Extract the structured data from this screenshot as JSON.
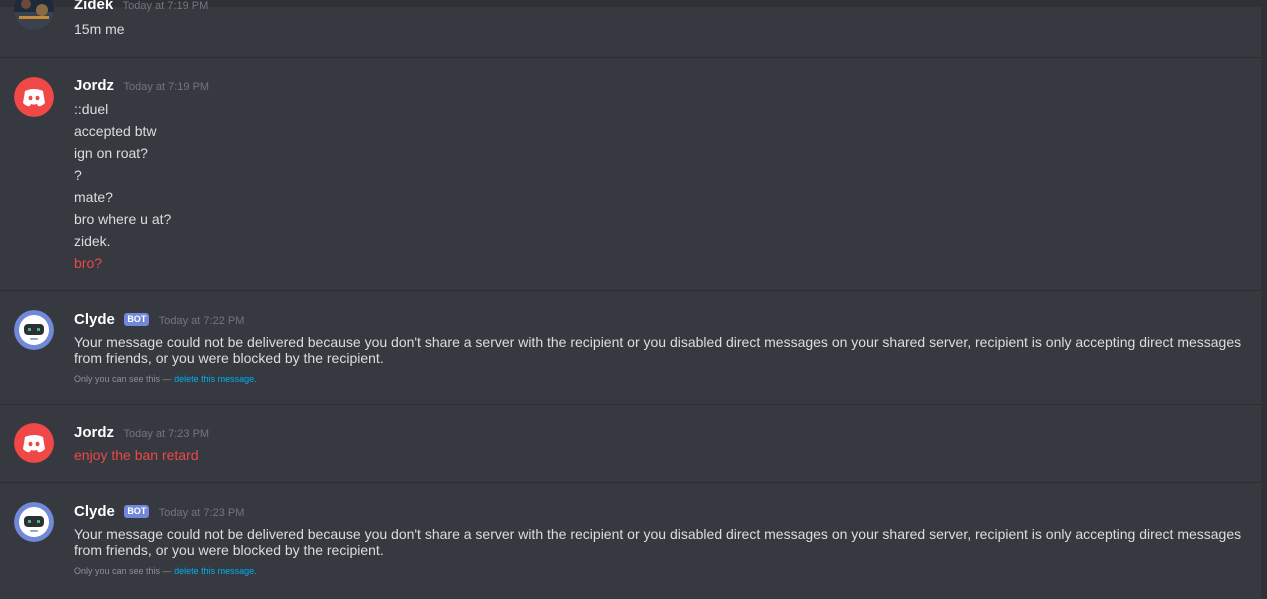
{
  "messages": [
    {
      "author": "Zidek",
      "timestamp": "Today at 7:19 PM",
      "bot": false,
      "lines": [
        "15m me"
      ]
    },
    {
      "author": "Jordz",
      "timestamp": "Today at 7:19 PM",
      "bot": false,
      "lines": [
        "::duel",
        "accepted btw",
        "ign on roat?",
        "?",
        "mate?",
        "bro where u at?",
        "zidek.",
        "bro?"
      ]
    },
    {
      "author": "Clyde",
      "timestamp": "Today at 7:22 PM",
      "bot": true,
      "bot_tag": "BOT",
      "text": "Your message could not be delivered because you don't share a server with the recipient or you disabled direct messages on your shared server, recipient is only accepting direct messages from friends, or you were blocked by the recipient.",
      "ephemeral_note": "Only you can see this —",
      "delete_link": "delete this message."
    },
    {
      "author": "Jordz",
      "timestamp": "Today at 7:23 PM",
      "bot": false,
      "lines": [
        "enjoy the ban retard"
      ]
    },
    {
      "author": "Clyde",
      "timestamp": "Today at 7:23 PM",
      "bot": true,
      "bot_tag": "BOT",
      "text": "Your message could not be delivered because you don't share a server with the recipient or you disabled direct messages on your shared server, recipient is only accepting direct messages from friends, or you were blocked by the recipient.",
      "ephemeral_note": "Only you can see this —",
      "delete_link": "delete this message."
    }
  ],
  "colors": {
    "background": "#36393f",
    "failed_message": "#f04747",
    "bot_tag": "#7289da",
    "link": "#00b0f4",
    "discord_red_avatar": "#f04747",
    "clyde_avatar": "#7289da"
  },
  "icons": {
    "zidek_avatar": "user-photo-avatar",
    "jordz_avatar": "discord-logo-avatar",
    "clyde_avatar": "clyde-bot-avatar"
  }
}
